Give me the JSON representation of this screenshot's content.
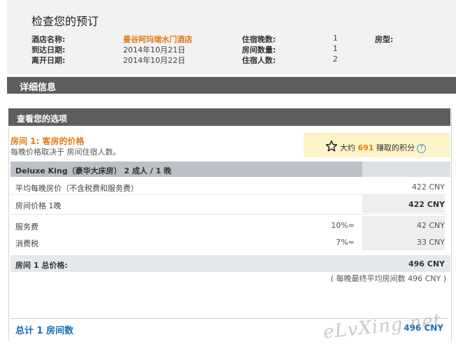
{
  "review": {
    "title": "检查您的预订",
    "hotel_name_label": "酒店名称:",
    "hotel_name": "曼谷阿玛瑞水门酒店",
    "arrival_label": "到达日期:",
    "arrival_date": "2014年10月21日",
    "departure_label": "离开日期:",
    "departure_date": "2014年10月22日",
    "nights_label": "住宿晚数:",
    "nights": "1",
    "rooms_label": "房间数量:",
    "rooms": "1",
    "guests_label": "住宿人数:",
    "guests": "2",
    "room_type_label": "房型:"
  },
  "details": {
    "title": "详细信息"
  },
  "options": {
    "header": "查看您的选项",
    "room_title": "房间 1: 客房的价格",
    "room_sub": "每晚价格取决于 房间住宿人数。",
    "points_prefix": "大约",
    "points_value": "691",
    "points_suffix": "赚取的积分",
    "room_bar": "Deluxe King（豪华大床房） 2 成人 / 1 晚",
    "avg_label": "平均每晚房价（不含税费和服务费）",
    "avg_value": "422 CNY",
    "price_label": "房间价格 1晚",
    "price_value": "422 CNY",
    "service_label": "服务费",
    "service_pct": "10%=",
    "service_value": "42 CNY",
    "tax_label": "消费税",
    "tax_pct": "7%=",
    "tax_value": "33 CNY",
    "total_label": "房间 1 总价格:",
    "total_value": "496 CNY",
    "avg_note": "( 每晚最终平均房间数   496 CNY )",
    "grand_label": "总计 1  房间数",
    "grand_value": "496 CNY"
  },
  "watermark": "eLvXing.net",
  "colors": {
    "accent_orange": "#e47911",
    "link_blue": "#1a6fb5",
    "header_gray": "#5e5e5e",
    "points_bg": "#fff4c7"
  },
  "icons": {
    "star": "star-icon",
    "help": "help-icon"
  }
}
